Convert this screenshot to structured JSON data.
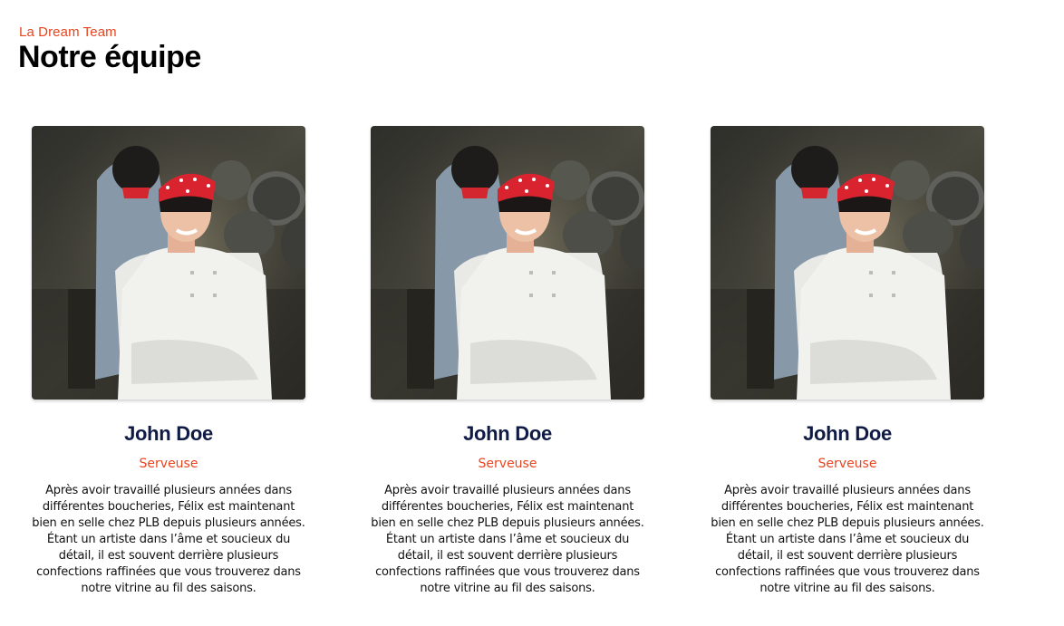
{
  "header": {
    "eyebrow": "La Dream Team",
    "title": "Notre équipe"
  },
  "colors": {
    "accent": "#e8441f",
    "name": "#0f1b45",
    "text": "#111111"
  },
  "team": {
    "members": [
      {
        "name": "John Doe",
        "role": "Serveuse",
        "bio": "Après avoir travaillé plusieurs années dans différentes boucheries, Félix est maintenant bien en selle chez PLB depuis plusieurs années. Étant un artiste dans l’âme et soucieux du détail, il est souvent derrière plusieurs confections raffinées que vous trouverez dans notre vitrine au fil des saisons.",
        "photo_icon": "chef-portrait-image"
      },
      {
        "name": "John Doe",
        "role": "Serveuse",
        "bio": "Après avoir travaillé plusieurs années dans différentes boucheries, Félix est maintenant bien en selle chez PLB depuis plusieurs années. Étant un artiste dans l’âme et soucieux du détail, il est souvent derrière plusieurs confections raffinées que vous trouverez dans notre vitrine au fil des saisons.",
        "photo_icon": "chef-portrait-image"
      },
      {
        "name": "John Doe",
        "role": "Serveuse",
        "bio": "Après avoir travaillé plusieurs années dans différentes boucheries, Félix est maintenant bien en selle chez PLB depuis plusieurs années. Étant un artiste dans l’âme et soucieux du détail, il est souvent derrière plusieurs confections raffinées que vous trouverez dans notre vitrine au fil des saisons.",
        "photo_icon": "chef-portrait-image"
      }
    ]
  }
}
